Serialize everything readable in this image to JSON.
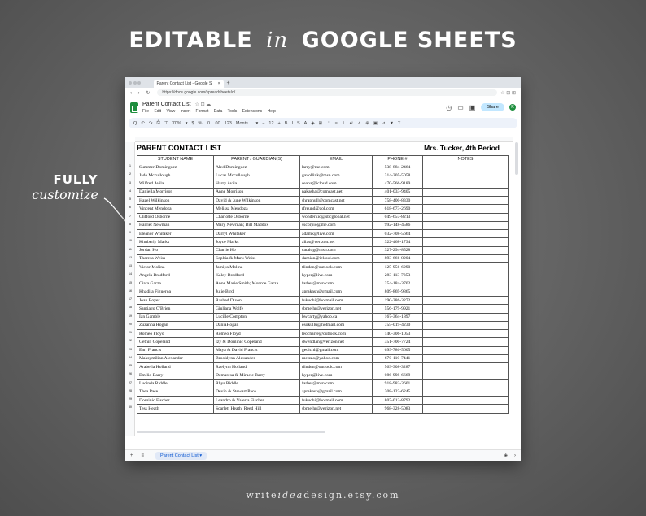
{
  "headline": {
    "part1": "EDITABLE",
    "part2": "in",
    "part3": "GOOGLE SHEETS"
  },
  "side_text": {
    "line1": "FULLY",
    "line2": "customize"
  },
  "footer": {
    "pre": "write",
    "mid": "idea",
    "post": "design.etsy.com"
  },
  "browser": {
    "tab_title": "Parent Contact List - Google S",
    "tab_close": "×",
    "new_tab": "+",
    "nav": "‹ › ↻",
    "url": "https://docs.google.com/spreadsheets/d/",
    "ext_icons": "☆ ⊡ ⊞"
  },
  "app": {
    "doc_title": "Parent Contact List",
    "title_icons": "☆ ⊡ ☁",
    "menus": [
      "File",
      "Edit",
      "View",
      "Insert",
      "Format",
      "Data",
      "Tools",
      "Extensions",
      "Help"
    ],
    "history_icon": "◷",
    "comment_icon": "▭",
    "meet_icon": "▣",
    "share_label": "Share",
    "avatar_letter": "R"
  },
  "toolbar": [
    "Q",
    "↶",
    "↷",
    "⎙",
    "⊤",
    "70%",
    "▾",
    "$",
    "%",
    ".0",
    ".00",
    "123",
    "Monts...",
    "▾",
    "−",
    "12",
    "+",
    "B",
    "I",
    "S",
    "A",
    "◈",
    "⊞",
    "⋮",
    "≡",
    "⊥",
    "↵",
    "∠",
    "⊕",
    "▣",
    "⊿",
    "▼",
    "Σ"
  ],
  "sheet": {
    "title": "PARENT CONTACT LIST",
    "class_label": "Mrs. Tucker, 4th Period",
    "headers": [
      "STUDENT NAME",
      "PARENT / GUARDIAN(S)",
      "EMAIL",
      "PHONE #",
      "NOTES"
    ],
    "rows": [
      [
        "Summer Dominguez",
        "Aled Dominguez",
        "larry@me.com",
        "538-884-2464",
        ""
      ],
      [
        "Jade Mccullough",
        "Lucas Mccullough",
        "gavollink@msn.com",
        "314-205-5058",
        ""
      ],
      [
        "Wilfred Avila",
        "Harry Avila",
        "seana@icloud.com",
        "470-566-9189",
        ""
      ],
      [
        "Daniella Morrison",
        "Anne Morrison",
        "nakasha@comcast.net",
        "401-033-9405",
        ""
      ],
      [
        "Hazel Wilkinson",
        "David & June Wilkinson",
        "shrapnull@comcast.net",
        "758-400-8330",
        ""
      ],
      [
        "Vincent Mendoza",
        "Melissa Mendoza",
        "rfreund@aol.com",
        "618-673-2690",
        ""
      ],
      [
        "Clifford Osborne",
        "Charlotte Osborne",
        "wonderkid@sbcglobal.net",
        "049-657-8213",
        ""
      ],
      [
        "Harriet Newman",
        "Mary Newman; Bill Maddox",
        "sscorpio@me.com",
        "992-148-4586",
        ""
      ],
      [
        "Eleanor Whitaker",
        "Darryl Whitaker",
        "adamk@live.com",
        "032-708-5664",
        ""
      ],
      [
        "Kimberly Marks",
        "Joyce Marks",
        "alias@verizon.net",
        "322-468-1734",
        ""
      ],
      [
        "Jordan Ho",
        "Charlie Ho",
        "catalog@msn.com",
        "327-294-8528",
        ""
      ],
      [
        "Theresa Weiss",
        "Sophia & Mark Weiss",
        "damian@icloud.com",
        "893-666-8204",
        ""
      ],
      [
        "Victor Molina",
        "Jamiya Molina",
        "tlinden@outlook.com",
        "125-956-6290",
        ""
      ],
      [
        "Angela Bradford",
        "Kaley Bradford",
        "hyper@live.com",
        "283-113-7353",
        ""
      ],
      [
        "Ciara Garza",
        "Anne Marie Smith; Monroe Garza",
        "farber@msn.com",
        "254-184-3702",
        ""
      ],
      [
        "Khadija Figueroa",
        "Julie Bird",
        "aprakash@gmail.com",
        "809-869-9865",
        ""
      ],
      [
        "Joan Boyer",
        "Rashad Dixon",
        "fukuchi@hotmail.com",
        "190-286-3272",
        ""
      ],
      [
        "Santiago O'Brien",
        "Giuliana Wolfe",
        "sbmejhr@verizon.net",
        "556-179-9921",
        ""
      ],
      [
        "Ian Gamble",
        "Lucille Compton",
        "bwcarty@yahoo.ca",
        "167-364-1897",
        ""
      ],
      [
        "Zuzanna Hogan",
        "DaniaHogan",
        "esokullu@hotmail.com",
        "755-019-4230",
        ""
      ],
      [
        "Romeo Floyd",
        "Romeo Floyd",
        "leocharre@outlook.com",
        "140-306-1053",
        ""
      ],
      [
        "Gethin Copeland",
        "Izy & Dominic Copeland",
        "dwendlan@verizon.net",
        "351-700-7724",
        ""
      ],
      [
        "Earl Francis",
        "Maya & David Francis",
        "gedichl@gmail.com",
        "699-786-5605",
        ""
      ],
      [
        "Maksymilian Alexander",
        "Brooklynn Alexander",
        "metzzo@yahoo.com",
        "670-110-7441",
        ""
      ],
      [
        "Arabella Holland",
        "Raelynn Holland",
        "tlinden@outlook.com",
        "563-308-3287",
        ""
      ],
      [
        "Emilio Barry",
        "Demaresa & Miracle Barry",
        "hyper@live.com",
        "086-998-6669",
        ""
      ],
      [
        "Lucinda Riddle",
        "Rhys Riddle",
        "farber@msn.com",
        "918-982-3601",
        ""
      ],
      [
        "Thea Pace",
        "Devin & Stewart Pace",
        "aprakash@gmail.com",
        "308-123-6245",
        ""
      ],
      [
        "Dominic Fischer",
        "Leandro & Valeria Fischer",
        "fukuchi@hotmail.com",
        "807-012-8792",
        ""
      ],
      [
        "Tess Heath",
        "Scarlett Heath; Reed Hill",
        "sbmejhr@verizon.net",
        "968-328-5083",
        ""
      ]
    ]
  },
  "sheetbar": {
    "add": "+",
    "all_sheets": "≡",
    "tab_label": "Parent Contact List",
    "tab_caret": "▾",
    "explore_icon": "◈",
    "collapse_icon": "›"
  }
}
